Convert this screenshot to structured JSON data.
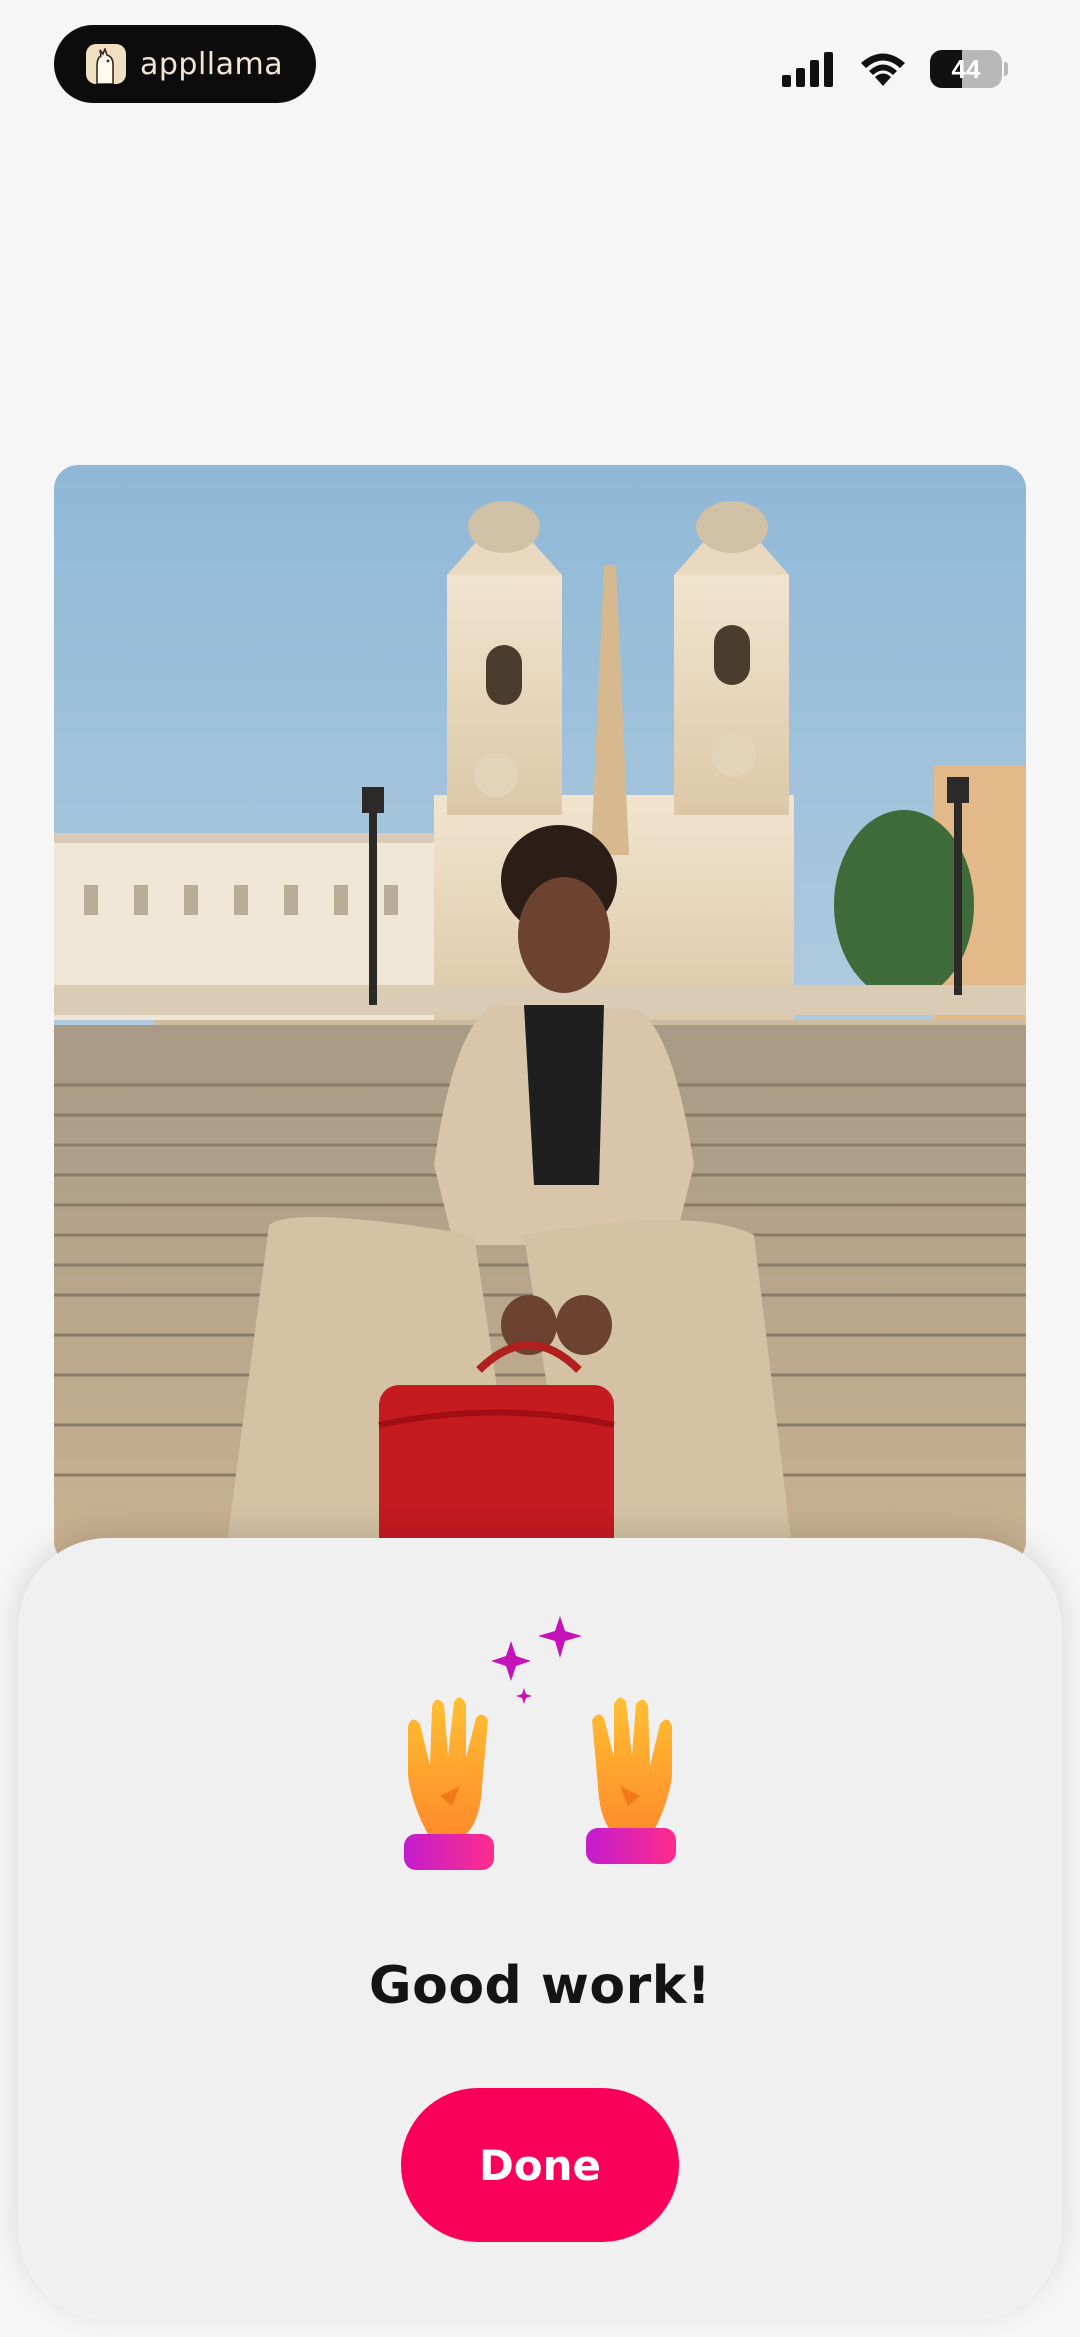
{
  "status_bar": {
    "brand_name": "appllama",
    "battery_percent": 44,
    "battery_label": "44",
    "brand_icon": "llama-logo-icon",
    "signal_icon": "cellular-signal-icon",
    "wifi_icon": "wifi-icon"
  },
  "photo": {
    "icon": "photo-of-woman-on-spanish-steps"
  },
  "sheet": {
    "title": "Good work!",
    "celebration_icon": "raised-hands-sparkles-icon",
    "done_label": "Done"
  },
  "colors": {
    "accent": "#fa0058",
    "sheet_background": "#f0f0f1",
    "page_background": "#f6f6f6"
  }
}
